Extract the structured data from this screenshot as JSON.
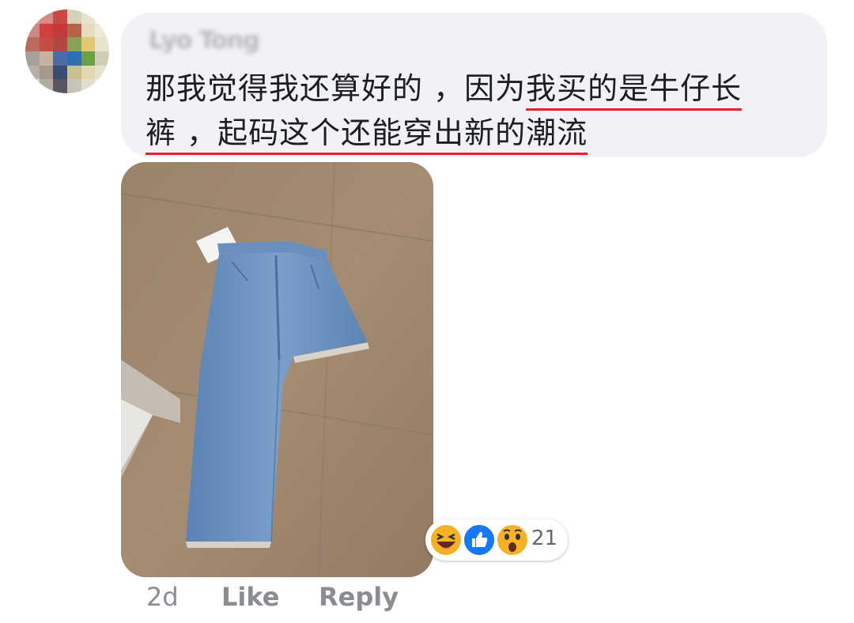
{
  "comment": {
    "author": "Lyo Tong",
    "text_part1": "那我觉得我还算好的 ，因为",
    "text_highlight1": "我买的是牛仔长",
    "text_highlight2": "裤 ，起码这个还能穿出新的潮流",
    "underline_color": "#e4202b"
  },
  "attachment": {
    "alt": "jeans-photo"
  },
  "reactions": {
    "icons": [
      "haha-icon",
      "like-icon",
      "wow-icon"
    ],
    "count": "21"
  },
  "actions": {
    "time": "2d",
    "like_label": "Like",
    "reply_label": "Reply"
  },
  "colors": {
    "bubble_bg": "#f0f2f5",
    "text": "#1c1e21",
    "meta": "#8a8d91",
    "like_blue": "#1877f2",
    "emoji_yellow": "#f7b125"
  }
}
